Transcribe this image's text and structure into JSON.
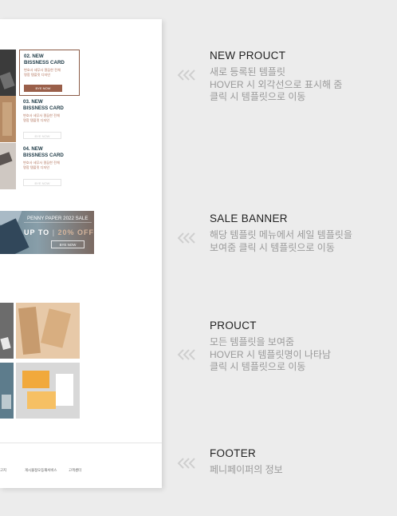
{
  "products": [
    {
      "title_line1": "02. NEW",
      "title_line2": "BISSNESS CARD",
      "desc_line1": "변호사 세무사 깔끔한 전체",
      "desc_line2": "명함 템플릿 디자인",
      "button": "BYE NOW"
    },
    {
      "title_line1": "03. NEW",
      "title_line2": "BISSNESS CARD",
      "desc_line1": "변호사 세무사 깔끔한 전체",
      "desc_line2": "명함 템플릿 디자인",
      "button": "BYE NOW"
    },
    {
      "title_line1": "04. NEW",
      "title_line2": "BISSNESS CARD",
      "desc_line1": "변호사 세무사 깔끔한 전체",
      "desc_line2": "명함 템플릿 디자인",
      "button": "BYE NOW"
    }
  ],
  "banner": {
    "title": "PENNY PAPER 2022 SALE",
    "up_to": "UP TO",
    "percent": "20% OFF",
    "button": "BYE NOW"
  },
  "footer": {
    "links": [
      "고지",
      "게시물정오등재서비스",
      "고객센터"
    ]
  },
  "annotations": [
    {
      "title": "NEW PROUCT",
      "lines": [
        "새로 등록된 템플릿",
        "HOVER 시 외각선으로 표시해 줌",
        "클릭 시 템플릿으로 이동"
      ]
    },
    {
      "title": "SALE BANNER",
      "lines": [
        "해당 템플릿 메뉴에서 세일 템플릿을",
        "보여줌 클릭 시 템플릿으로 이동"
      ]
    },
    {
      "title": "PROUCT",
      "lines": [
        "모든 템플릿을 보여줌",
        "HOVER 시 템플릿명이 나타남",
        "클릭 시 템플릿으로 이동"
      ]
    },
    {
      "title": "FOOTER",
      "lines": [
        "페니페이퍼의 정보"
      ]
    }
  ],
  "colors": {
    "accent_brown": "#9a5f4a",
    "title_navy": "#1e3a46",
    "annotation_grey": "#9a9a9a"
  },
  "icons": [
    "chevron-left-triple-icon"
  ]
}
